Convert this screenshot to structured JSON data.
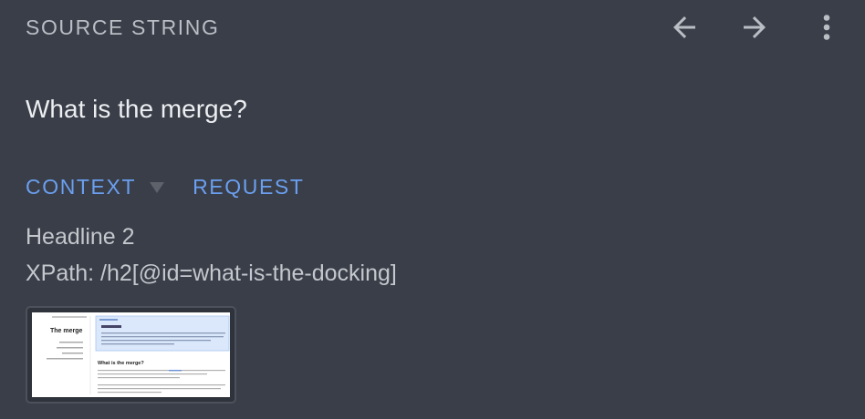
{
  "header": {
    "title": "SOURCE STRING",
    "prev_icon": "arrow-left-icon",
    "next_icon": "arrow-right-icon",
    "more_icon": "more-vert-icon"
  },
  "source": {
    "text": "What is the merge?"
  },
  "tabs": [
    {
      "label": "CONTEXT",
      "has_dropdown": true
    },
    {
      "label": "REQUEST",
      "has_dropdown": false
    }
  ],
  "context": {
    "element_type": "Headline 2",
    "xpath": "XPath: /h2[@id=what-is-the-docking]"
  },
  "screenshot": {
    "page_heading": "The merge",
    "section_heading": "What is the merge?"
  },
  "colors": {
    "background": "#393e48",
    "header_text": "#b9bdc4",
    "primary_text": "#eceef1",
    "accent": "#6b9ff0",
    "secondary_text": "#c4c7cc"
  }
}
